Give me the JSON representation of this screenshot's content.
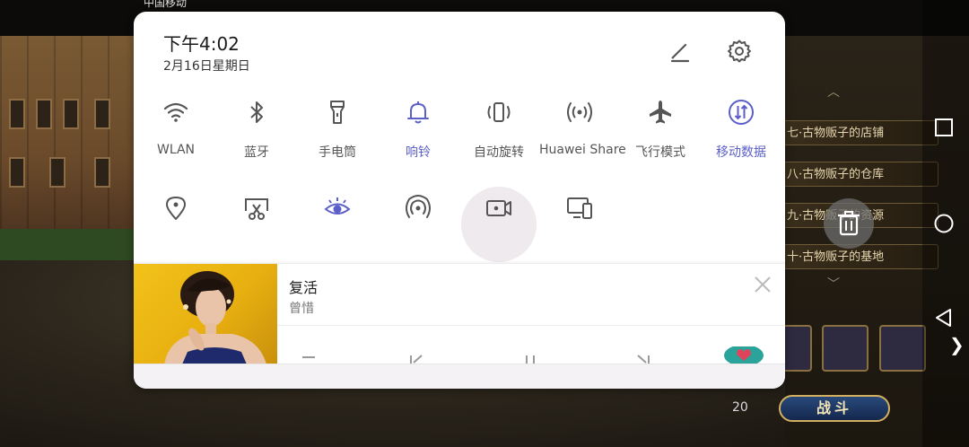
{
  "statusbar": {
    "carrier": "中国移动",
    "indicators": "◐ ⚫ ▮"
  },
  "panel": {
    "time": "下午4:02",
    "date": "2月16日星期日"
  },
  "tiles": [
    {
      "label": "WLAN",
      "icon": "wifi-icon",
      "active": false
    },
    {
      "label": "蓝牙",
      "icon": "bluetooth-icon",
      "active": false
    },
    {
      "label": "手电筒",
      "icon": "flashlight-icon",
      "active": false
    },
    {
      "label": "响铃",
      "icon": "bell-icon",
      "active": true
    },
    {
      "label": "自动旋转",
      "icon": "auto-rotate-icon",
      "active": false
    },
    {
      "label": "Huawei Share",
      "icon": "huawei-share-icon",
      "active": false
    },
    {
      "label": "飞行模式",
      "icon": "airplane-icon",
      "active": false
    },
    {
      "label": "移动数据",
      "icon": "mobile-data-icon",
      "active": true
    }
  ],
  "tiles_row2": [
    {
      "icon": "location-icon",
      "active": false
    },
    {
      "icon": "screenshot-icon",
      "active": false
    },
    {
      "icon": "eye-comfort-icon",
      "active": true
    },
    {
      "icon": "hotspot-icon",
      "active": false
    },
    {
      "icon": "screen-record-icon",
      "active": false
    },
    {
      "icon": "multi-screen-icon",
      "active": false
    }
  ],
  "media": {
    "title": "复活",
    "artist": "曾惜"
  },
  "game": {
    "quests": [
      "七·古物贩子的店铺",
      "八·古物贩子的仓库",
      "九·古物贩子的资源",
      "十·古物贩子的基地"
    ],
    "battle_label": "战斗",
    "gem_count": "20"
  },
  "colors": {
    "accent": "#5b5fc7",
    "inactive_icon": "#555555",
    "panel_bg": "#ffffff"
  }
}
